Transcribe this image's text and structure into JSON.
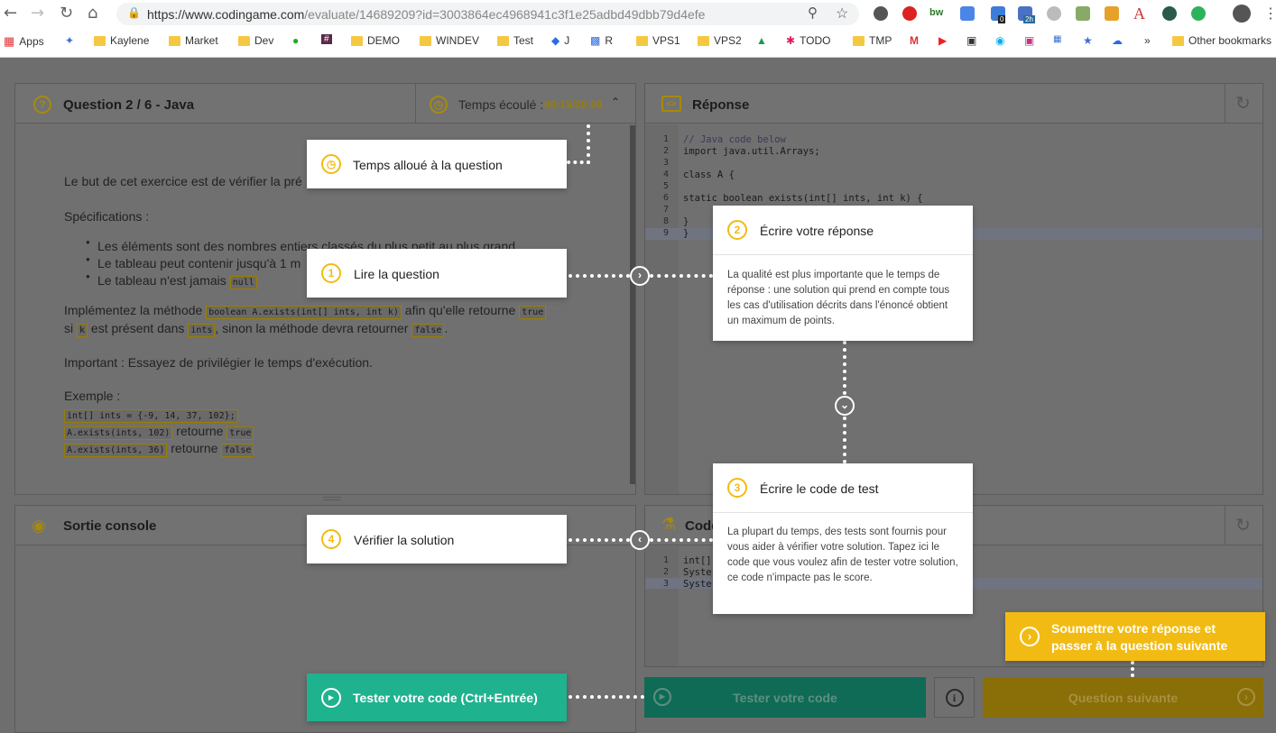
{
  "browser": {
    "url_main": "https://www.codingame.com",
    "url_rest": "/evaluate/14689209?id=3003864ec4968941c3f1e25adbd49dbb79d4efe",
    "bookmarks": [
      "Apps",
      "Kaylene",
      "Market",
      "Dev",
      "#",
      "DEMO",
      "WINDEV",
      "Test",
      "J",
      "R",
      "VPS1",
      "VPS2",
      "TODO",
      "TMP",
      "»",
      "Other bookmarks"
    ],
    "ext_badge_1": "0",
    "ext_badge_2": "2h",
    "ext_bw": "bw"
  },
  "question_panel": {
    "title": "Question 2 / 6 - Java",
    "timer_label": "Temps écoulé : ",
    "timer_value": "00:15/20:00",
    "intro": "Le but de cet exercice est de vérifier la pré",
    "spec_heading": "Spécifications :",
    "bullets": [
      "Les éléments sont des nombres entiers classés du plus petit au plus grand",
      "Le tableau peut contenir jusqu'à 1 m",
      "Le tableau n'est jamais "
    ],
    "bullet3_code": "null",
    "impl_a": "Implémentez la méthode ",
    "impl_code": "boolean A.exists(int[] ints, int k)",
    "impl_b": " afin qu'elle retourne ",
    "impl_true": "true",
    "impl_c": "si ",
    "impl_k": "k",
    "impl_d": " est présent dans ",
    "impl_ints": "ints",
    "impl_e": ", sinon la méthode devra retourner ",
    "impl_false": "false",
    "impl_f": ".",
    "important": "Important : Essayez de privilégier le temps d'exécution.",
    "example_heading": "Exemple :",
    "example_line1": "int[] ints = {-9, 14, 37, 102};",
    "example_line2": "A.exists(ints, 102)",
    "example_line3": "A.exists(ints, 36)",
    "returns": " retourne ",
    "ex_true": "true",
    "ex_false": "false"
  },
  "answer_panel": {
    "title": "Réponse",
    "lines": [
      {
        "n": "1",
        "code": "// Java code below"
      },
      {
        "n": "2",
        "code": "import java.util.Arrays;"
      },
      {
        "n": "3",
        "code": ""
      },
      {
        "n": "4",
        "code": "class A {"
      },
      {
        "n": "5",
        "code": ""
      },
      {
        "n": "6",
        "code": "    static boolean exists(int[] ints, int k) {"
      },
      {
        "n": "7",
        "code": ""
      },
      {
        "n": "8",
        "code": "    }"
      },
      {
        "n": "9",
        "code": "}"
      }
    ]
  },
  "console_panel": {
    "title": "Sortie console"
  },
  "test_panel": {
    "title": "Code",
    "lines": [
      {
        "n": "1",
        "code": "int[]"
      },
      {
        "n": "2",
        "code": "Syster"
      },
      {
        "n": "3",
        "code": "Syster"
      }
    ]
  },
  "buttons": {
    "test": "Tester votre code",
    "next": "Question suivante"
  },
  "callouts": {
    "time": {
      "title": "Temps alloué à la question"
    },
    "c1": {
      "num": "1",
      "title": "Lire la question"
    },
    "c2": {
      "num": "2",
      "title": "Écrire votre réponse",
      "desc": "La qualité est plus importante que le temps de réponse : une solution qui prend en compte tous les cas d'utilisation décrits dans l'énoncé obtient un maximum de points."
    },
    "c3": {
      "num": "3",
      "title": "Écrire le code de test",
      "desc": "La plupart du temps, des tests sont fournis pour vous aider à vérifier votre solution. Tapez ici le code que vous voulez afin de tester votre solution, ce code n'impacte pas le score."
    },
    "c4": {
      "num": "4",
      "title": "Vérifier la solution"
    },
    "test_run": {
      "title": "Tester votre code (Ctrl+Entrée)"
    },
    "submit": {
      "title": "Soumettre votre réponse et passer à la question suivante"
    }
  },
  "colors": {
    "accent": "#f2bb13",
    "test_green": "#1fb28f",
    "submit_yellow": "#f2bb13"
  }
}
